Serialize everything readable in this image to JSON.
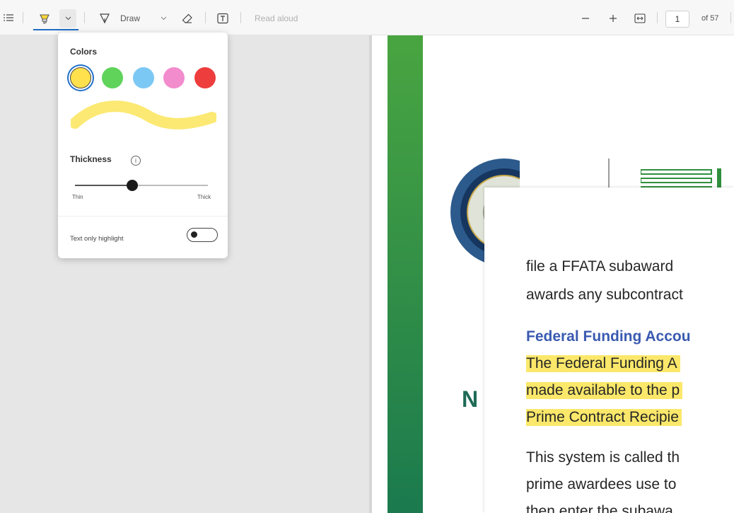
{
  "toolbar": {
    "draw_label": "Draw",
    "read_aloud_label": "Read aloud",
    "page_number": "1",
    "page_total": "of 57",
    "accent_color": "#1f6fc8"
  },
  "flyout": {
    "colors_label": "Colors",
    "swatches": [
      {
        "name": "yellow",
        "color": "#ffe14d",
        "selected": true
      },
      {
        "name": "green",
        "color": "#5fd35a",
        "selected": false
      },
      {
        "name": "blue",
        "color": "#7cc8f5",
        "selected": false
      },
      {
        "name": "pink",
        "color": "#f28ccd",
        "selected": false
      },
      {
        "name": "red",
        "color": "#ee3d3d",
        "selected": false
      }
    ],
    "preview_color": "#fbe973",
    "thickness_label": "Thickness",
    "thickness_value_percent": 43,
    "thin_label": "Thin",
    "thick_label": "Thick",
    "text_only_label": "Text only highlight",
    "text_only_on": false
  },
  "document": {
    "brand_green": "#3a9a47",
    "highlight_color": "#fbe86a",
    "n_letter": "N",
    "lines": [
      {
        "text": "file a FFATA subaward",
        "style": "body"
      },
      {
        "text": "awards any subcontract",
        "style": "body"
      },
      {
        "text": "Federal Funding Accou",
        "style": "heading"
      },
      {
        "text": "The Federal Funding A",
        "style": "highlight"
      },
      {
        "text": "made available to the p",
        "style": "highlight"
      },
      {
        "text": "Prime Contract Recipie",
        "style": "highlight"
      },
      {
        "text": "This system is called th",
        "style": "body"
      },
      {
        "text": "prime awardees use to",
        "style": "body"
      },
      {
        "text": "then enter the subawa",
        "style": "body"
      }
    ]
  }
}
